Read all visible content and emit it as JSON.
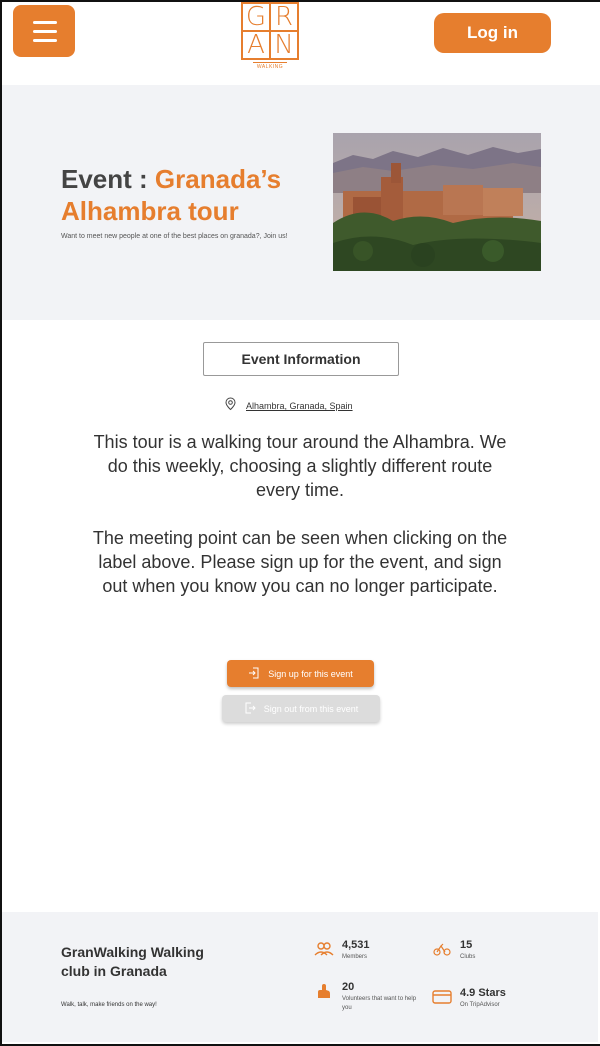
{
  "header": {
    "logo_letters": [
      "G",
      "R",
      "A",
      "N"
    ],
    "logo_subtitle": "WALKING",
    "login_label": "Log in",
    "accent_color": "#e67e2e"
  },
  "hero": {
    "title_prefix": "Event : ",
    "title_accent": "Granada’s Alhambra tour",
    "subtitle": "Want to meet new people at one of the best places on granada?, Join us!"
  },
  "event": {
    "info_button_label": "Event Information",
    "location": "Alhambra, Granada, Spain",
    "description_1": "This tour is a walking tour around the Alhambra. We do this weekly, choosing a slightly different route every time.",
    "description_2": "The meeting point can be seen when clicking on the label above. Please sign up for the event, and sign out when you know you can no longer participate.",
    "signup_label": "Sign up for this event",
    "signout_label": "Sign out from this event"
  },
  "footer": {
    "title": "GranWalking Walking club in Granada",
    "tagline": "Walk, talk, make friends on the way!",
    "stats": [
      {
        "value": "4,531",
        "label": "Members",
        "icon": "members-icon"
      },
      {
        "value": "15",
        "label": "Clubs",
        "icon": "clubs-icon"
      },
      {
        "value": "20",
        "label": "Volunteers that want to help you",
        "icon": "volunteers-icon"
      },
      {
        "value": "4.9 Stars",
        "label": "On TripAdvisor",
        "icon": "rating-card-icon"
      }
    ]
  }
}
